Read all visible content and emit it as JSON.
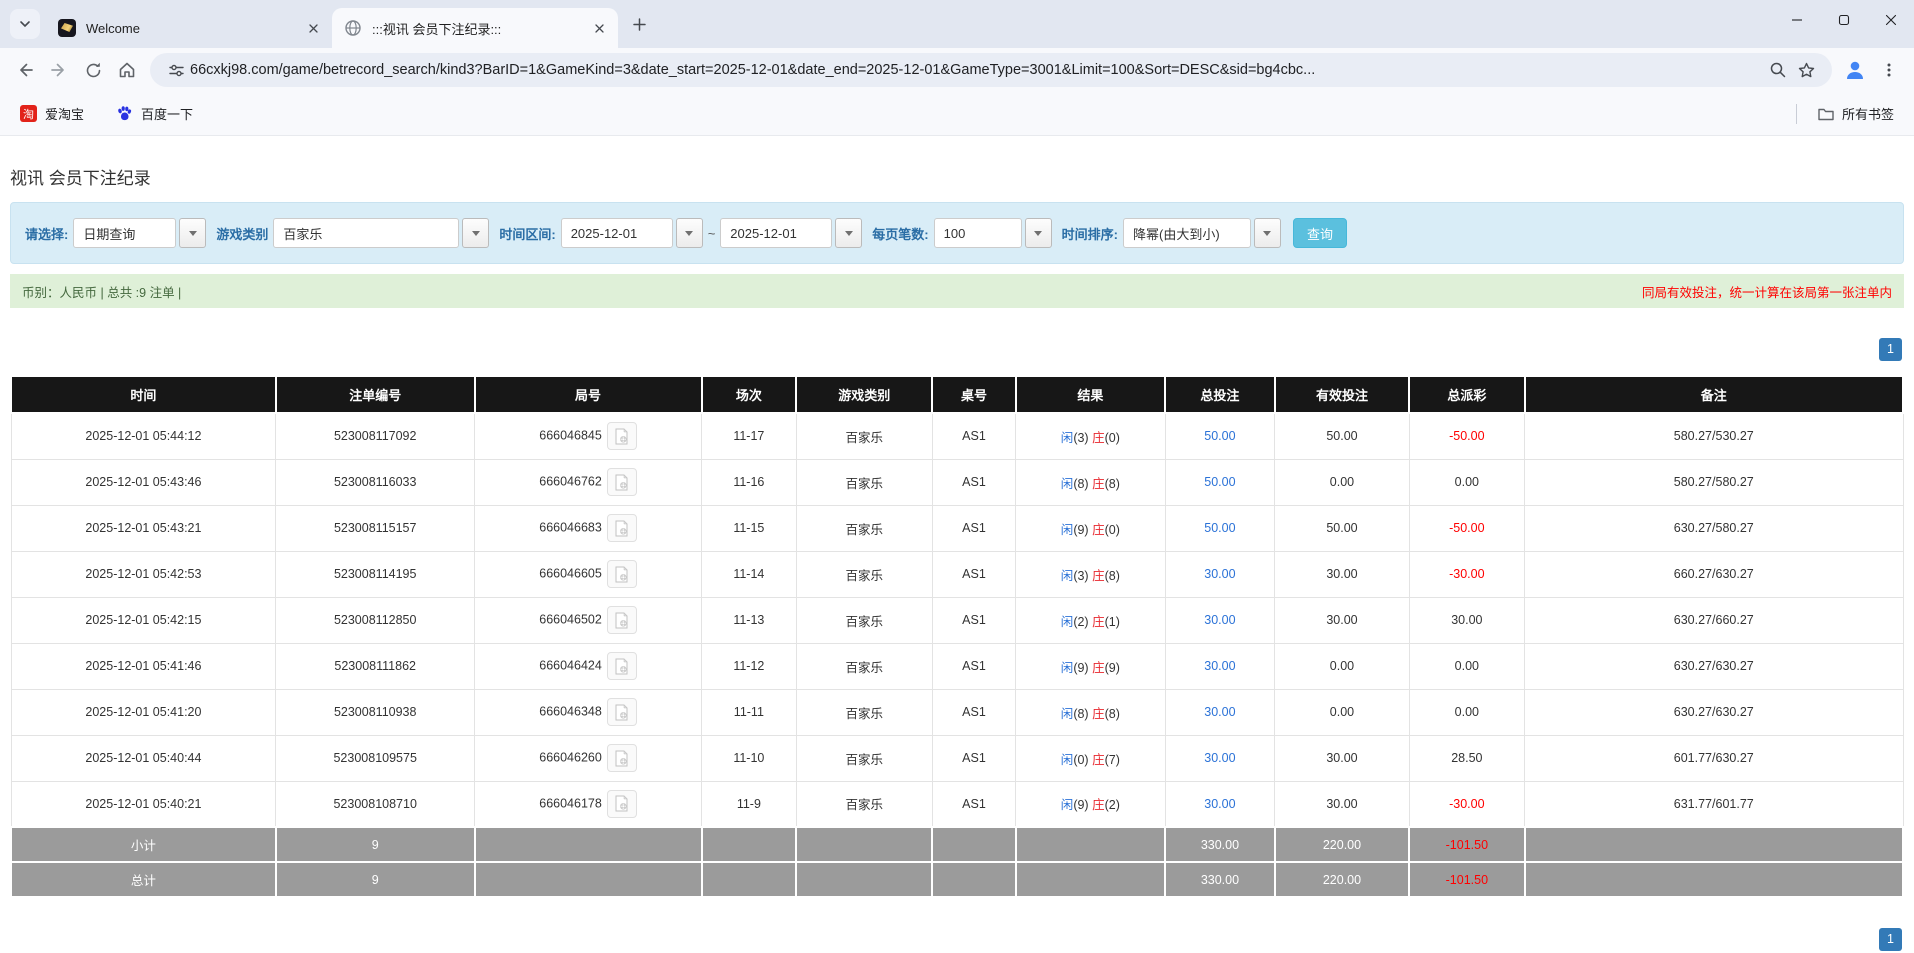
{
  "browser": {
    "tabs": [
      {
        "title": "Welcome"
      },
      {
        "title": ":::视讯 会员下注纪录:::"
      }
    ],
    "url": "66cxkj98.com/game/betrecord_search/kind3?BarID=1&GameKind=3&date_start=2025-12-01&date_end=2025-12-01&GameType=3001&Limit=100&Sort=DESC&sid=bg4cbc...",
    "bookmarks": [
      {
        "label": "爱淘宝",
        "icon_char": "淘"
      },
      {
        "label": "百度一下"
      }
    ],
    "all_bookmarks_label": "所有书签"
  },
  "page": {
    "title": "视讯 会员下注纪录",
    "filters": {
      "select_label": "请选择:",
      "select_value": "日期查询",
      "game_type_label": "游戏类别",
      "game_type_value": "百家乐",
      "date_range_label": "时间区间:",
      "date_start": "2025-12-01",
      "date_separator": "~",
      "date_end": "2025-12-01",
      "page_size_label": "每页笔数:",
      "page_size_value": "100",
      "sort_label": "时间排序:",
      "sort_value": "降幂(由大到小)",
      "search_button": "查询"
    },
    "summary": {
      "left": "币别：人民币 | 总共 :9 注单 |",
      "right": "同局有效投注，统一计算在该局第一张注单内"
    },
    "pagination": "1",
    "colors": {
      "accent_button": "#5bc0de",
      "pager_blue": "#337ab7",
      "link_blue": "#2b72d7",
      "negative_red": "#ff0000",
      "player_blue": "#2b72d7",
      "banker_red": "#e8262d"
    },
    "table": {
      "headers": [
        "时间",
        "注单编号",
        "局号",
        "场次",
        "游戏类别",
        "桌号",
        "结果",
        "总投注",
        "有效投注",
        "总派彩",
        "备注"
      ],
      "col_widths": [
        "14%",
        "10.5%",
        "12%",
        "5%",
        "7.2%",
        "4.4%",
        "7.9%",
        "5.8%",
        "7.1%",
        "6.1%",
        "20%"
      ],
      "rows": [
        {
          "time": "2025-12-01 05:44:12",
          "bet_id": "523008117092",
          "round": "666046845",
          "session": "11-17",
          "game": "百家乐",
          "table_no": "AS1",
          "player_label": "闲",
          "player_value": "(3)",
          "banker_label": "庄",
          "banker_value": "(0)",
          "total_bet": "50.00",
          "valid_bet": "50.00",
          "payout": "-50.00",
          "note": "580.27/530.27"
        },
        {
          "time": "2025-12-01 05:43:46",
          "bet_id": "523008116033",
          "round": "666046762",
          "session": "11-16",
          "game": "百家乐",
          "table_no": "AS1",
          "player_label": "闲",
          "player_value": "(8)",
          "banker_label": "庄",
          "banker_value": "(8)",
          "total_bet": "50.00",
          "valid_bet": "0.00",
          "payout": "0.00",
          "note": "580.27/580.27"
        },
        {
          "time": "2025-12-01 05:43:21",
          "bet_id": "523008115157",
          "round": "666046683",
          "session": "11-15",
          "game": "百家乐",
          "table_no": "AS1",
          "player_label": "闲",
          "player_value": "(9)",
          "banker_label": "庄",
          "banker_value": "(0)",
          "total_bet": "50.00",
          "valid_bet": "50.00",
          "payout": "-50.00",
          "note": "630.27/580.27"
        },
        {
          "time": "2025-12-01 05:42:53",
          "bet_id": "523008114195",
          "round": "666046605",
          "session": "11-14",
          "game": "百家乐",
          "table_no": "AS1",
          "player_label": "闲",
          "player_value": "(3)",
          "banker_label": "庄",
          "banker_value": "(8)",
          "total_bet": "30.00",
          "valid_bet": "30.00",
          "payout": "-30.00",
          "note": "660.27/630.27"
        },
        {
          "time": "2025-12-01 05:42:15",
          "bet_id": "523008112850",
          "round": "666046502",
          "session": "11-13",
          "game": "百家乐",
          "table_no": "AS1",
          "player_label": "闲",
          "player_value": "(2)",
          "banker_label": "庄",
          "banker_value": "(1)",
          "total_bet": "30.00",
          "valid_bet": "30.00",
          "payout": "30.00",
          "note": "630.27/660.27"
        },
        {
          "time": "2025-12-01 05:41:46",
          "bet_id": "523008111862",
          "round": "666046424",
          "session": "11-12",
          "game": "百家乐",
          "table_no": "AS1",
          "player_label": "闲",
          "player_value": "(9)",
          "banker_label": "庄",
          "banker_value": "(9)",
          "total_bet": "30.00",
          "valid_bet": "0.00",
          "payout": "0.00",
          "note": "630.27/630.27"
        },
        {
          "time": "2025-12-01 05:41:20",
          "bet_id": "523008110938",
          "round": "666046348",
          "session": "11-11",
          "game": "百家乐",
          "table_no": "AS1",
          "player_label": "闲",
          "player_value": "(8)",
          "banker_label": "庄",
          "banker_value": "(8)",
          "total_bet": "30.00",
          "valid_bet": "0.00",
          "payout": "0.00",
          "note": "630.27/630.27"
        },
        {
          "time": "2025-12-01 05:40:44",
          "bet_id": "523008109575",
          "round": "666046260",
          "session": "11-10",
          "game": "百家乐",
          "table_no": "AS1",
          "player_label": "闲",
          "player_value": "(0)",
          "banker_label": "庄",
          "banker_value": "(7)",
          "total_bet": "30.00",
          "valid_bet": "30.00",
          "payout": "28.50",
          "note": "601.77/630.27"
        },
        {
          "time": "2025-12-01 05:40:21",
          "bet_id": "523008108710",
          "round": "666046178",
          "session": "11-9",
          "game": "百家乐",
          "table_no": "AS1",
          "player_label": "闲",
          "player_value": "(9)",
          "banker_label": "庄",
          "banker_value": "(2)",
          "total_bet": "30.00",
          "valid_bet": "30.00",
          "payout": "-30.00",
          "note": "631.77/601.77"
        }
      ],
      "footer_rows": [
        {
          "label": "小计",
          "count": "9",
          "total_bet": "330.00",
          "valid_bet": "220.00",
          "payout": "-101.50"
        },
        {
          "label": "总计",
          "count": "9",
          "total_bet": "330.00",
          "valid_bet": "220.00",
          "payout": "-101.50"
        }
      ]
    }
  }
}
